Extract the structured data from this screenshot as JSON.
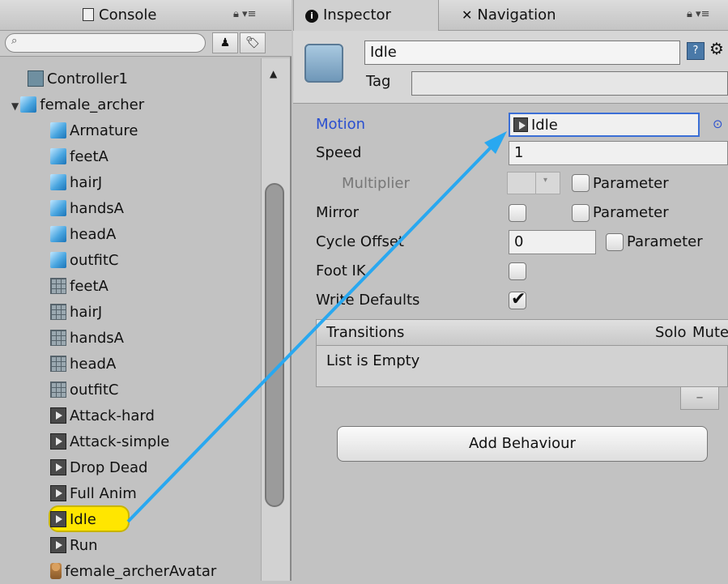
{
  "left_panel": {
    "tab_label": "Console",
    "tree": [
      {
        "label": "Controller1",
        "icon": "controller-icon",
        "type": "controller"
      },
      {
        "label": "female_archer",
        "icon": "model-icon",
        "type": "model"
      },
      {
        "label": "Armature",
        "icon": "model-icon",
        "type": "model"
      },
      {
        "label": "feetA",
        "icon": "model-icon",
        "type": "model"
      },
      {
        "label": "hairJ",
        "icon": "model-icon",
        "type": "model"
      },
      {
        "label": "handsA",
        "icon": "model-icon",
        "type": "model"
      },
      {
        "label": "headA",
        "icon": "model-icon",
        "type": "model"
      },
      {
        "label": "outfitC",
        "icon": "model-icon",
        "type": "model"
      },
      {
        "label": "feetA",
        "icon": "mesh-icon",
        "type": "mesh"
      },
      {
        "label": "hairJ",
        "icon": "mesh-icon",
        "type": "mesh"
      },
      {
        "label": "handsA",
        "icon": "mesh-icon",
        "type": "mesh"
      },
      {
        "label": "headA",
        "icon": "mesh-icon",
        "type": "mesh"
      },
      {
        "label": "outfitC",
        "icon": "mesh-icon",
        "type": "mesh"
      },
      {
        "label": "Attack-hard",
        "icon": "animation-clip-icon",
        "type": "clip"
      },
      {
        "label": "Attack-simple",
        "icon": "animation-clip-icon",
        "type": "clip"
      },
      {
        "label": "Drop Dead",
        "icon": "animation-clip-icon",
        "type": "clip"
      },
      {
        "label": "Full Anim",
        "icon": "animation-clip-icon",
        "type": "clip"
      },
      {
        "label": "Idle",
        "icon": "animation-clip-icon",
        "type": "clip",
        "selected": true
      },
      {
        "label": "Run",
        "icon": "animation-clip-icon",
        "type": "clip"
      },
      {
        "label": "female_archerAvatar",
        "icon": "avatar-icon",
        "type": "avatar"
      }
    ]
  },
  "inspector": {
    "tab_inspector": "Inspector",
    "tab_navigation": "Navigation",
    "name_value": "Idle",
    "tag_label": "Tag",
    "motion_label": "Motion",
    "motion_value": "Idle",
    "speed_label": "Speed",
    "speed_value": "1",
    "multiplier_label": "Multiplier",
    "parameter_label": "Parameter",
    "mirror_label": "Mirror",
    "cycle_offset_label": "Cycle Offset",
    "cycle_offset_value": "0",
    "foot_ik_label": "Foot IK",
    "write_defaults_label": "Write Defaults",
    "write_defaults_checked": true,
    "transitions_title": "Transitions",
    "solo_label": "Solo",
    "mute_label": "Mute",
    "list_empty_text": "List is Empty",
    "minus_label": "–",
    "add_behaviour_label": "Add Behaviour"
  },
  "colors": {
    "motion_label": "#2a4fd0",
    "arrow": "#29a8f0",
    "selection": "#ffe600"
  }
}
